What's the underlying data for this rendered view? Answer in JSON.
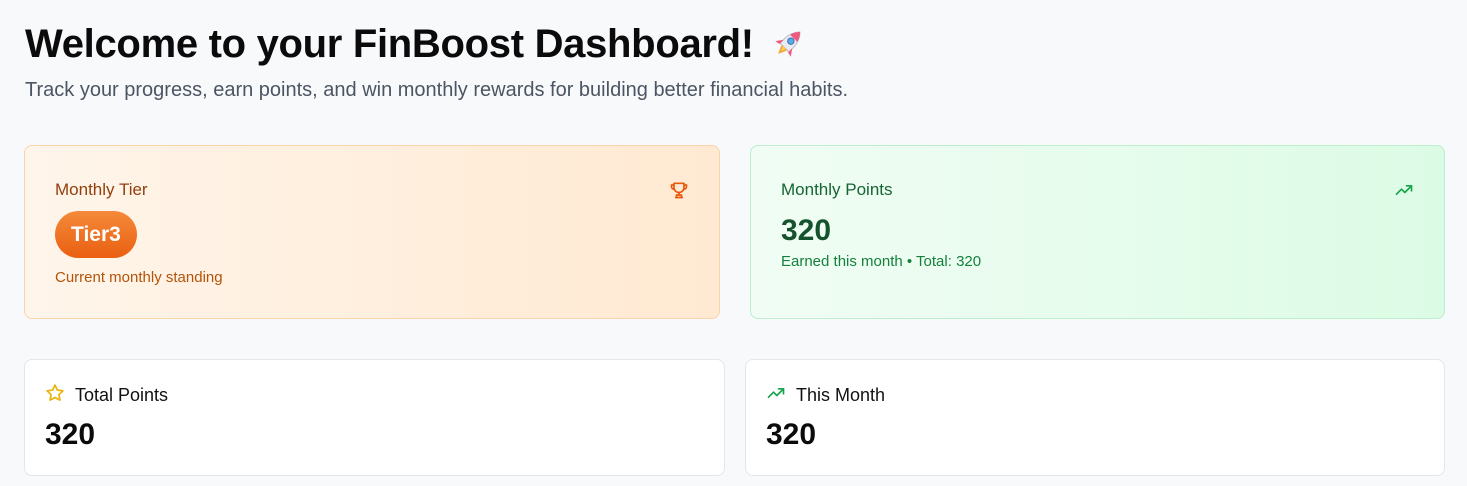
{
  "header": {
    "title": "Welcome to your FinBoost Dashboard!",
    "title_icon": "rocket-icon",
    "subtitle": "Track your progress, earn points, and win monthly rewards for building better financial habits."
  },
  "tier_card": {
    "label": "Monthly Tier",
    "icon": "trophy-icon",
    "tier": "Tier3",
    "caption": "Current monthly standing"
  },
  "points_card": {
    "label": "Monthly Points",
    "icon": "trending-up-icon",
    "value": "320",
    "caption": "Earned this month • Total: 320"
  },
  "stats": {
    "total": {
      "label": "Total Points",
      "icon": "star-icon",
      "value": "320"
    },
    "month": {
      "label": "This Month",
      "icon": "trending-up-icon",
      "value": "320"
    }
  },
  "colors": {
    "tier_accent": "#ea580c",
    "points_accent": "#16a34a",
    "star": "#eab308"
  }
}
